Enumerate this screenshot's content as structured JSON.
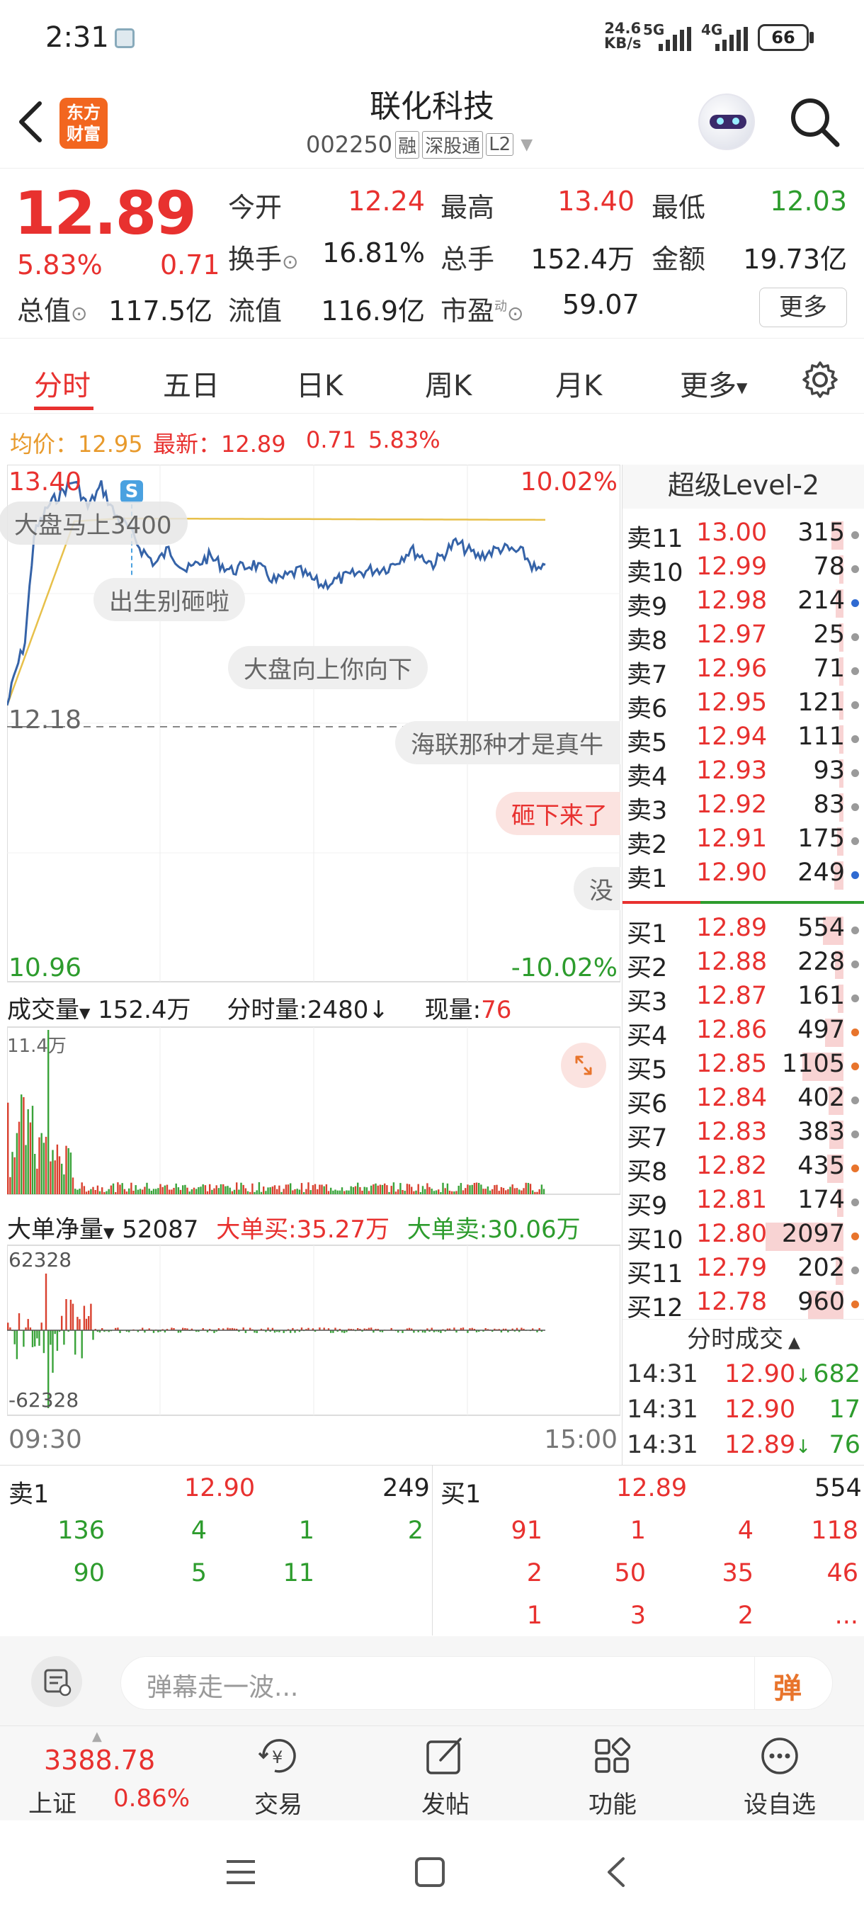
{
  "status_bar": {
    "time": "2:31",
    "net_speed": "24.6",
    "net_unit": "KB/s",
    "sig1": "5G",
    "sig2": "4G",
    "battery": "66"
  },
  "header": {
    "brand_line1": "东方",
    "brand_line2": "财富",
    "title": "联化科技",
    "code": "002250",
    "tag1": "融",
    "tag2": "深股通",
    "tag3": "L2"
  },
  "quote": {
    "price": "12.89",
    "change_pct": "5.83%",
    "change": "0.71",
    "open_label": "今开",
    "open": "12.24",
    "high_label": "最高",
    "high": "13.40",
    "low_label": "最低",
    "low": "12.03",
    "turnover_label": "换手",
    "turnover": "16.81%",
    "volume_label": "总手",
    "volume": "152.4万",
    "amount_label": "金额",
    "amount": "19.73亿",
    "mcap_label": "总值",
    "mcap": "117.5亿",
    "float_label": "流值",
    "float_mcap": "116.9亿",
    "pe_label": "市盈",
    "pe_sup": "动",
    "pe": "59.07",
    "more_button": "更多"
  },
  "tabs": [
    "分时",
    "五日",
    "日K",
    "周K",
    "月K",
    "更多"
  ],
  "avg_bar": {
    "avg_label": "均价：",
    "avg": "12.95",
    "last_label": "最新：",
    "last": "12.89",
    "chg": "0.71",
    "pct": "5.83%"
  },
  "chart": {
    "price_high": "13.40",
    "pct_high": "10.02%",
    "price_mid": "12.18",
    "price_low": "10.96",
    "pct_low": "-10.02%",
    "vol_label": "成交量",
    "vol_total": "152.4万",
    "vol_seg_label": "分时量:",
    "vol_seg": "2480",
    "cur_label": "现量:",
    "cur": "76",
    "vol_max": "11.4万",
    "net_label": "大单净量",
    "net_value": "52087",
    "big_buy": "大单买:35.27万",
    "big_sell": "大单卖:30.06万",
    "net_max": "62328",
    "net_min": "-62328",
    "time_start": "09:30",
    "time_end": "15:00",
    "s_marker": "S",
    "bubbles": [
      "大盘马上3400",
      "出生别砸啦",
      "大盘向上你向下",
      "海联那种才是真牛",
      "砸下来了",
      "没"
    ]
  },
  "level2": {
    "title": "超级Level-2",
    "asks": [
      {
        "label": "卖11",
        "price": "13.00",
        "qty": "315",
        "dot": "#9a9a9a"
      },
      {
        "label": "卖10",
        "price": "12.99",
        "qty": "78",
        "dot": "#9a9a9a"
      },
      {
        "label": "卖9",
        "price": "12.98",
        "qty": "214",
        "dot": "#2f6ad1"
      },
      {
        "label": "卖8",
        "price": "12.97",
        "qty": "25",
        "dot": "#9a9a9a"
      },
      {
        "label": "卖7",
        "price": "12.96",
        "qty": "71",
        "dot": "#9a9a9a"
      },
      {
        "label": "卖6",
        "price": "12.95",
        "qty": "121",
        "dot": "#9a9a9a"
      },
      {
        "label": "卖5",
        "price": "12.94",
        "qty": "111",
        "dot": "#9a9a9a"
      },
      {
        "label": "卖4",
        "price": "12.93",
        "qty": "93",
        "dot": "#9a9a9a"
      },
      {
        "label": "卖3",
        "price": "12.92",
        "qty": "83",
        "dot": "#9a9a9a"
      },
      {
        "label": "卖2",
        "price": "12.91",
        "qty": "175",
        "dot": "#9a9a9a"
      },
      {
        "label": "卖1",
        "price": "12.90",
        "qty": "249",
        "dot": "#2f6ad1"
      }
    ],
    "bids": [
      {
        "label": "买1",
        "price": "12.89",
        "qty": "554",
        "dot": "#9a9a9a"
      },
      {
        "label": "买2",
        "price": "12.88",
        "qty": "228",
        "dot": "#9a9a9a"
      },
      {
        "label": "买3",
        "price": "12.87",
        "qty": "161",
        "dot": "#9a9a9a"
      },
      {
        "label": "买4",
        "price": "12.86",
        "qty": "497",
        "dot": "#e8742c"
      },
      {
        "label": "买5",
        "price": "12.85",
        "qty": "1105",
        "dot": "#e8742c"
      },
      {
        "label": "买6",
        "price": "12.84",
        "qty": "402",
        "dot": "#9a9a9a"
      },
      {
        "label": "买7",
        "price": "12.83",
        "qty": "383",
        "dot": "#9a9a9a"
      },
      {
        "label": "买8",
        "price": "12.82",
        "qty": "435",
        "dot": "#e8742c"
      },
      {
        "label": "买9",
        "price": "12.81",
        "qty": "174",
        "dot": "#9a9a9a"
      },
      {
        "label": "买10",
        "price": "12.80",
        "qty": "2097",
        "dot": "#e8742c"
      },
      {
        "label": "买11",
        "price": "12.79",
        "qty": "202",
        "dot": "#9a9a9a"
      },
      {
        "label": "买12",
        "price": "12.78",
        "qty": "960",
        "dot": "#e8742c"
      }
    ],
    "ticks_title": "分时成交",
    "ticks": [
      {
        "time": "14:31",
        "price": "12.90",
        "qty": "682"
      },
      {
        "time": "14:31",
        "price": "12.90",
        "qty": "17"
      },
      {
        "time": "14:31",
        "price": "12.89",
        "qty": "76"
      }
    ]
  },
  "summary": {
    "sell_label": "卖1",
    "sell_price": "12.90",
    "sell_qty": "249",
    "buy_label": "买1",
    "buy_price": "12.89",
    "buy_qty": "554",
    "sell_rows": [
      [
        "136",
        "4",
        "1",
        "2"
      ],
      [
        "90",
        "5",
        "11",
        ""
      ]
    ],
    "buy_rows": [
      [
        "91",
        "1",
        "4",
        "118"
      ],
      [
        "2",
        "50",
        "35",
        "46"
      ],
      [
        "1",
        "3",
        "2",
        "..."
      ]
    ]
  },
  "comment": {
    "placeholder": "弹幕走一波...",
    "danmaku_button": "弹"
  },
  "bottom_nav": {
    "index_value": "3388.78",
    "index_name": "上证",
    "index_pct": "0.86%",
    "items": [
      "交易",
      "发帖",
      "功能",
      "设自选"
    ]
  }
}
